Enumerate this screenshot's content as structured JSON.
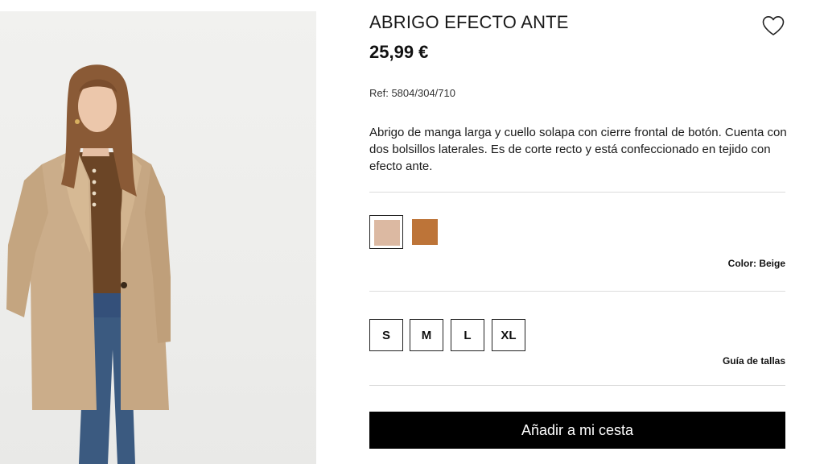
{
  "product": {
    "title": "ABRIGO EFECTO ANTE",
    "price": "25,99 €",
    "ref": "Ref: 5804/304/710",
    "description": "Abrigo de manga larga y cuello solapa con cierre frontal de botón. Cuenta con dos bolsillos laterales. Es de corte recto y está confeccionado en tejido con efecto ante.",
    "image_alt": "Model wearing beige suede-effect coat"
  },
  "colors": {
    "swatches": [
      {
        "name": "Beige",
        "hex": "#dcb9a2",
        "selected": true
      },
      {
        "name": "Camel",
        "hex": "#bd7438",
        "selected": false
      }
    ],
    "label": "Color: Beige"
  },
  "sizes": {
    "options": [
      "S",
      "M",
      "L",
      "XL"
    ],
    "guide_label": "Guía de tallas"
  },
  "cta": {
    "label": "Añadir a mi cesta"
  },
  "icons": {
    "favorite": "heart-outline-icon"
  },
  "theme": {
    "accent": "#000000",
    "coat": "#c9ab88",
    "top": "#6b4526",
    "jeans": "#3b5a80"
  }
}
